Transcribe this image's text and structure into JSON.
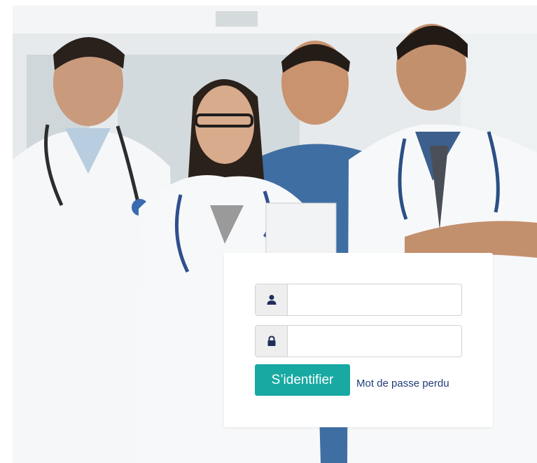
{
  "login": {
    "username_value": "",
    "password_value": "",
    "submit_label": "S’identifier",
    "lost_password_label": "Mot de passe perdu"
  },
  "icons": {
    "username": "user-icon",
    "password": "lock-icon"
  },
  "colors": {
    "accent": "#17a9a2",
    "link": "#1f3d7a",
    "icon": "#1f2f5c",
    "card_background": "#ffffff"
  }
}
